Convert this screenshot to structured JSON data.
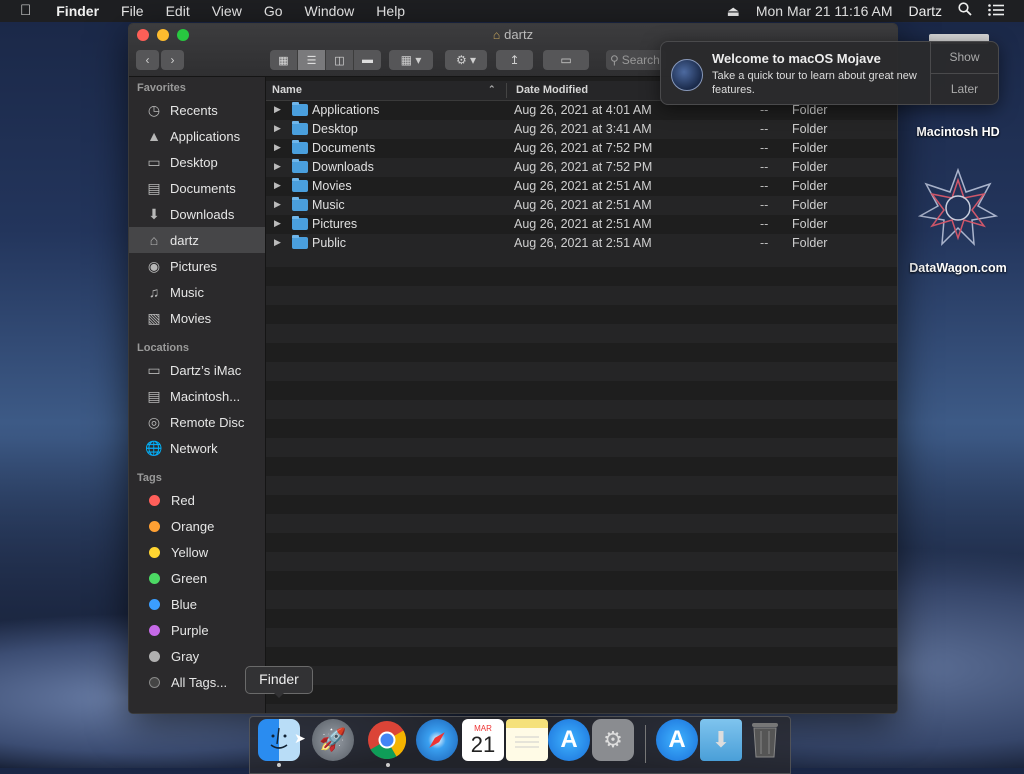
{
  "menubar": {
    "app": "Finder",
    "menus": [
      "File",
      "Edit",
      "View",
      "Go",
      "Window",
      "Help"
    ],
    "datetime": "Mon Mar 21  11:16 AM",
    "user": "Dartz"
  },
  "window": {
    "title": "dartz",
    "search_placeholder": "Search",
    "columns": {
      "name": "Name",
      "date": "Date Modified"
    }
  },
  "sidebar": {
    "favorites_label": "Favorites",
    "favorites": [
      {
        "label": "Recents",
        "icon": "clock-icon"
      },
      {
        "label": "Applications",
        "icon": "applications-icon"
      },
      {
        "label": "Desktop",
        "icon": "desktop-icon"
      },
      {
        "label": "Documents",
        "icon": "document-icon"
      },
      {
        "label": "Downloads",
        "icon": "download-icon"
      },
      {
        "label": "dartz",
        "icon": "home-icon",
        "selected": true
      },
      {
        "label": "Pictures",
        "icon": "camera-icon"
      },
      {
        "label": "Music",
        "icon": "music-icon"
      },
      {
        "label": "Movies",
        "icon": "film-icon"
      }
    ],
    "locations_label": "Locations",
    "locations": [
      {
        "label": "Dartz’s iMac",
        "icon": "imac-icon"
      },
      {
        "label": "Macintosh...",
        "icon": "disk-icon"
      },
      {
        "label": "Remote Disc",
        "icon": "disc-icon"
      },
      {
        "label": "Network",
        "icon": "network-icon"
      }
    ],
    "tags_label": "Tags",
    "tags": [
      {
        "label": "Red",
        "color": "#ff5f5a"
      },
      {
        "label": "Orange",
        "color": "#ffa033"
      },
      {
        "label": "Yellow",
        "color": "#ffd531"
      },
      {
        "label": "Green",
        "color": "#4cd964"
      },
      {
        "label": "Blue",
        "color": "#3b9eff"
      },
      {
        "label": "Purple",
        "color": "#c66ae8"
      },
      {
        "label": "Gray",
        "color": "#b0b0b0"
      }
    ],
    "all_tags": "All Tags..."
  },
  "files": [
    {
      "name": "Applications",
      "date": "Aug 26, 2021 at 4:01 AM",
      "size": "--",
      "kind": "Folder"
    },
    {
      "name": "Desktop",
      "date": "Aug 26, 2021 at 3:41 AM",
      "size": "--",
      "kind": "Folder"
    },
    {
      "name": "Documents",
      "date": "Aug 26, 2021 at 7:52 PM",
      "size": "--",
      "kind": "Folder"
    },
    {
      "name": "Downloads",
      "date": "Aug 26, 2021 at 7:52 PM",
      "size": "--",
      "kind": "Folder"
    },
    {
      "name": "Movies",
      "date": "Aug 26, 2021 at 2:51 AM",
      "size": "--",
      "kind": "Folder"
    },
    {
      "name": "Music",
      "date": "Aug 26, 2021 at 2:51 AM",
      "size": "--",
      "kind": "Folder"
    },
    {
      "name": "Pictures",
      "date": "Aug 26, 2021 at 2:51 AM",
      "size": "--",
      "kind": "Folder"
    },
    {
      "name": "Public",
      "date": "Aug 26, 2021 at 2:51 AM",
      "size": "--",
      "kind": "Folder"
    }
  ],
  "notification": {
    "title": "Welcome to macOS Mojave",
    "body": "Take a quick tour to learn about great new features.",
    "show": "Show",
    "later": "Later"
  },
  "desktop": {
    "hd_label": "Macintosh HD",
    "datawagon_label": "DataWagon.com"
  },
  "tooltip": "Finder",
  "dock": {
    "calendar_month": "MAR",
    "calendar_day": "21"
  }
}
